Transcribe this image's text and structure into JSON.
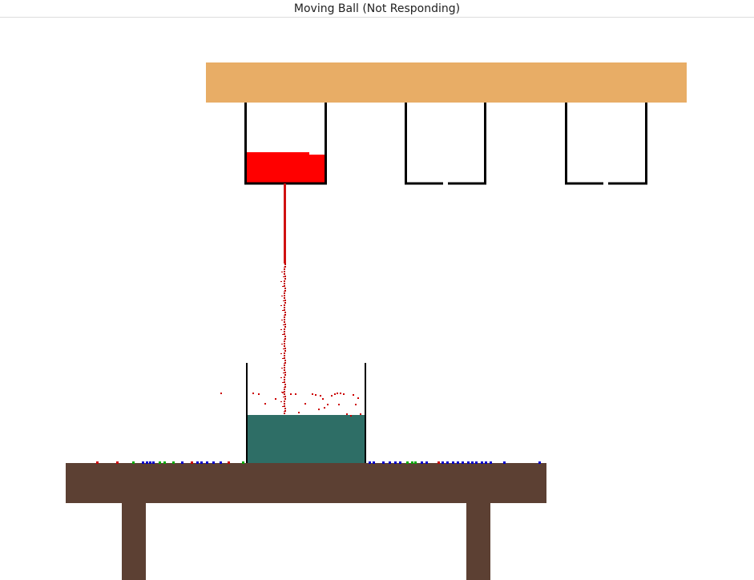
{
  "window": {
    "title": "Moving Ball (Not Responding)"
  },
  "scene": {
    "shelf_color": "#e8ad66",
    "table_color": "#5c4033",
    "beaker_liquid_color": "#2e6e66",
    "pouring_liquid_color": "#ff0000",
    "droplet_colors": [
      "#cc0000",
      "#0000cc",
      "#00aa00"
    ],
    "hanging_containers": [
      {
        "name": "container-1",
        "state": "filled",
        "fill_color": "#ff0000"
      },
      {
        "name": "container-2",
        "state": "empty"
      },
      {
        "name": "container-3",
        "state": "empty"
      }
    ]
  }
}
